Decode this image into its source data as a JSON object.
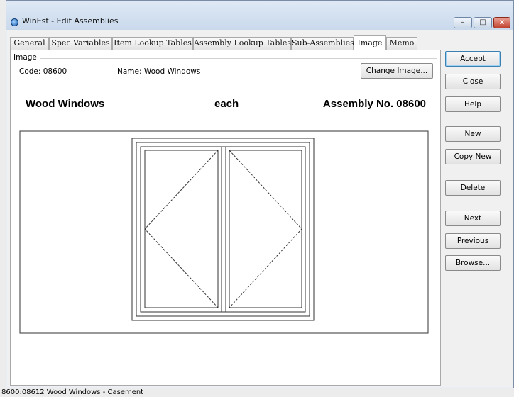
{
  "window": {
    "title": "WinEst - Edit Assemblies",
    "minimize_glyph": "–",
    "maximize_glyph": "□",
    "close_glyph": "x"
  },
  "tabs": [
    {
      "label": "General"
    },
    {
      "label": "Spec Variables"
    },
    {
      "label": "Item Lookup Tables"
    },
    {
      "label": "Assembly Lookup Tables"
    },
    {
      "label": "Sub-Assemblies"
    },
    {
      "label": "Image",
      "active": true
    },
    {
      "label": "Memo"
    }
  ],
  "panel": {
    "group_label": "Image",
    "code_text": "Code:  08600",
    "name_text": "Name: Wood Windows",
    "change_image_label": "Change Image..."
  },
  "image": {
    "title_left": "Wood Windows",
    "title_center": "each",
    "title_right": "Assembly No. 08600"
  },
  "sidebar": {
    "accept": "Accept",
    "close": "Close",
    "help": "Help",
    "new": "New",
    "copy_new": "Copy New",
    "delete": "Delete",
    "next": "Next",
    "previous": "Previous",
    "browse": "Browse..."
  },
  "status": {
    "text": "8600:08612  Wood Windows - Casement"
  }
}
